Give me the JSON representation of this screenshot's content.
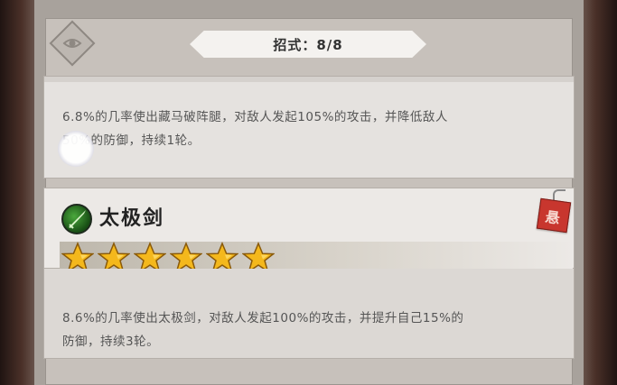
{
  "header": {
    "title": "招式：8/8"
  },
  "skill_1": {
    "desc_line1": "6.8%的几率使出藏马破阵腿，对敌人发起105%的攻击，并降低敌人",
    "desc_line2": "50%的防御，持续1轮。"
  },
  "skill_2": {
    "name": "太极剑",
    "tag_label": "悬",
    "stars": 6,
    "desc_line1": "8.6%的几率使出太极剑，对敌人发起100%的攻击，并提升自己15%的",
    "desc_line2": "防御，持续3轮。"
  },
  "icons": [
    "eye-icon",
    "sword-icon",
    "star-icon",
    "tag-icon"
  ],
  "colors": {
    "star": "#f4b81c",
    "tag": "#c8362e",
    "skill_icon": "#2f8a2a"
  }
}
